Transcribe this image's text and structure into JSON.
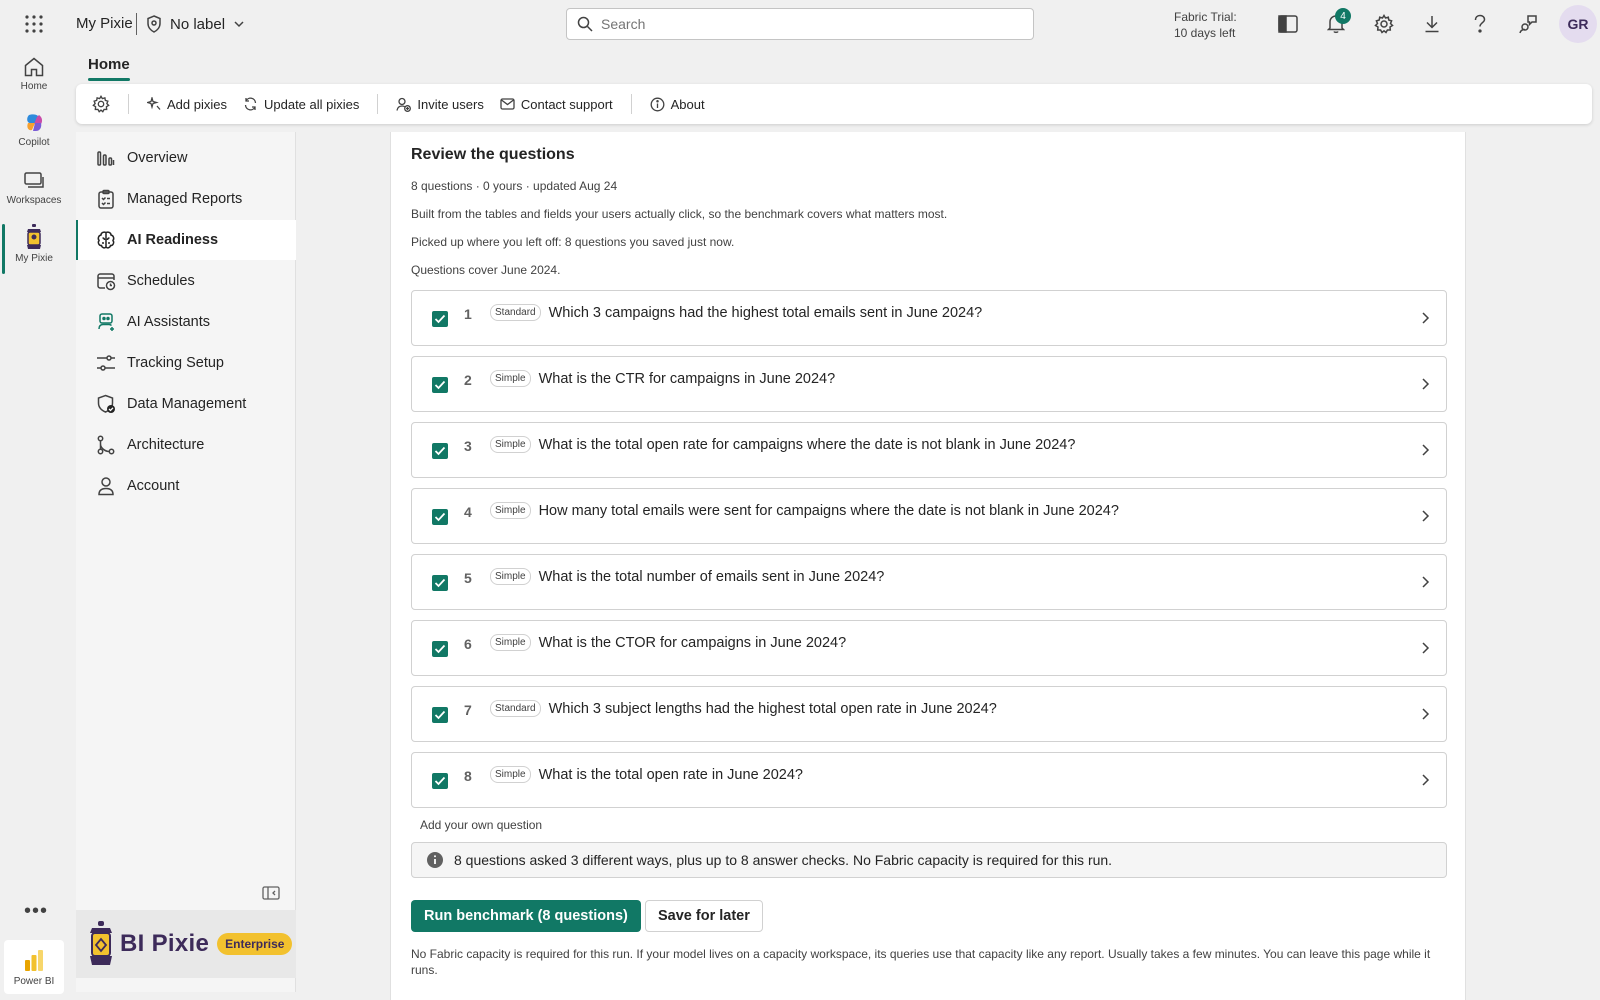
{
  "topbar": {
    "app_name": "My Pixie",
    "sensitivity_label": "No label",
    "search_placeholder": "Search",
    "trial_line1": "Fabric Trial:",
    "trial_line2": "10 days left",
    "notification_count": "4",
    "avatar_initials": "GR"
  },
  "rail": {
    "items": [
      {
        "label": "Home",
        "icon": "home-icon"
      },
      {
        "label": "Copilot",
        "icon": "copilot-icon"
      },
      {
        "label": "Workspaces",
        "icon": "workspaces-icon"
      },
      {
        "label": "My Pixie",
        "icon": "pixie-lantern-icon",
        "active": true
      }
    ],
    "more": "•••",
    "product": "Power BI"
  },
  "main": {
    "tab": "Home",
    "toolbar": {
      "add_pixies": "Add pixies",
      "update_all": "Update all pixies",
      "invite_users": "Invite users",
      "contact_support": "Contact support",
      "about": "About"
    }
  },
  "sidenav": {
    "items": [
      {
        "label": "Overview",
        "icon": "bar-chart-icon"
      },
      {
        "label": "Managed Reports",
        "icon": "clipboard-icon"
      },
      {
        "label": "AI Readiness",
        "icon": "brain-icon",
        "active": true
      },
      {
        "label": "Schedules",
        "icon": "calendar-clock-icon"
      },
      {
        "label": "AI Assistants",
        "icon": "bot-icon"
      },
      {
        "label": "Tracking Setup",
        "icon": "sliders-icon"
      },
      {
        "label": "Data Management",
        "icon": "shield-check-icon"
      },
      {
        "label": "Architecture",
        "icon": "branch-icon"
      },
      {
        "label": "Account",
        "icon": "person-icon"
      }
    ],
    "brand_name": "BI Pixie",
    "brand_badge": "Enterprise"
  },
  "content": {
    "title": "Review the questions",
    "meta": "8 questions · 0 yours · updated Aug 24",
    "line1": "Built from the tables and fields your users actually click, so the benchmark covers what matters most.",
    "line2": "Picked up where you left off: 8 questions you saved just now.",
    "line3": "Questions cover June 2024.",
    "questions": [
      {
        "num": "1",
        "tag": "Standard",
        "text": "Which 3 campaigns had the highest total emails sent in June 2024?",
        "checked": true
      },
      {
        "num": "2",
        "tag": "Simple",
        "text": "What is the CTR for campaigns in June 2024?",
        "checked": true
      },
      {
        "num": "3",
        "tag": "Simple",
        "text": "What is the total open rate for campaigns where the date is not blank in June 2024?",
        "checked": true
      },
      {
        "num": "4",
        "tag": "Simple",
        "text": "How many total emails were sent for campaigns where the date is not blank in June 2024?",
        "checked": true
      },
      {
        "num": "5",
        "tag": "Simple",
        "text": "What is the total number of emails sent in June 2024?",
        "checked": true
      },
      {
        "num": "6",
        "tag": "Simple",
        "text": "What is the CTOR for campaigns in June 2024?",
        "checked": true
      },
      {
        "num": "7",
        "tag": "Standard",
        "text": "Which 3 subject lengths had the highest total open rate in June 2024?",
        "checked": true
      },
      {
        "num": "8",
        "tag": "Simple",
        "text": "What is the total open rate in June 2024?",
        "checked": true
      }
    ],
    "add_question": "Add your own question",
    "info": "8 questions asked 3 different ways, plus up to 8 answer checks. No Fabric capacity is required for this run.",
    "run_button": "Run benchmark (8 questions)",
    "save_button": "Save for later",
    "footnote": "No Fabric capacity is required for this run. If your model lives on a capacity workspace, its queries use that capacity like any report. Usually takes a few minutes. You can leave this page while it runs."
  },
  "colors": {
    "accent": "#117865",
    "brand_purple": "#3d2b5a",
    "brand_yellow": "#f2c12e"
  }
}
